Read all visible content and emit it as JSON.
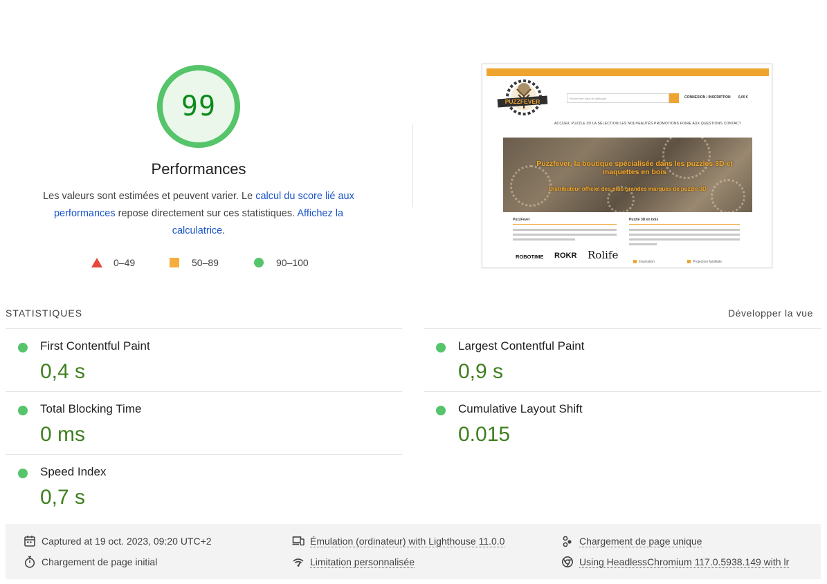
{
  "score": {
    "value": "99",
    "fraction": 0.99,
    "color": "#0c8a1b",
    "title": "Performances",
    "desc_part1": "Les valeurs sont estimées et peuvent varier. Le ",
    "desc_link1": "calcul du score lié aux performances",
    "desc_part2": " repose directement sur ces statistiques. ",
    "desc_link2": "Affichez la calculatrice",
    "desc_part3": "."
  },
  "legend": {
    "fail": "0–49",
    "average": "50–89",
    "pass": "90–100"
  },
  "thumbnail": {
    "search_placeholder": "Rechercher dans le catalogue",
    "account": "CONNEXION / INSCRIPTION",
    "cart": "0,00 €",
    "logo_text": "PUZZFEVER",
    "nav": "ACCUEIL   PUZZLE 3D   LA SÉLECTION   LES NOUVEAUTÉS   PROMOTIONS   FOIRE AUX QUESTIONS   CONTACT",
    "hero_title": "Puzzfever, la boutique spécialisée dans les puzzles 3D et maquettes en bois",
    "hero_sub": "Distributeur officiel des plus grandes marques de puzzle 3D",
    "col1_title": "PuzzFever",
    "col2_title": "Puzzle 3D en bois",
    "brand1": "ROBOTIME",
    "brand2": "ROKR",
    "brand3": "Rolife",
    "link1": "Inspiration",
    "link2": "Projection familiale"
  },
  "metrics": {
    "section_title": "STATISTIQUES",
    "expand_label": "Développer la vue",
    "fcp": {
      "name": "First Contentful Paint",
      "value": "0,4 s"
    },
    "lcp": {
      "name": "Largest Contentful Paint",
      "value": "0,9 s"
    },
    "tbt": {
      "name": "Total Blocking Time",
      "value": "0 ms"
    },
    "cls": {
      "name": "Cumulative Layout Shift",
      "value": "0.015"
    },
    "si": {
      "name": "Speed Index",
      "value": "0,7 s"
    }
  },
  "footer": {
    "captured": "Captured at 19 oct. 2023, 09:20 UTC+2",
    "initial_load": "Chargement de page initial",
    "emulation": "Émulation (ordinateur) with Lighthouse 11.0.0",
    "throttling": "Limitation personnalisée",
    "single_load": "Chargement de page unique",
    "browser": "Using HeadlessChromium 117.0.5938.149 with lr"
  },
  "colors": {
    "pass": "#55c46a",
    "average": "#f5ae3d",
    "fail": "#e5473b",
    "metric_value": "#3f7f1f",
    "link": "#1a55c9"
  }
}
